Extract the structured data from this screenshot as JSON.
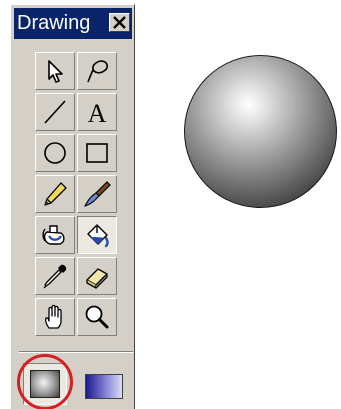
{
  "toolbox": {
    "title": "Drawing",
    "close_icon": "close-x-icon",
    "tools": [
      {
        "name": "arrow-tool",
        "icon": "arrow-icon",
        "pressed": false
      },
      {
        "name": "lasso-tool",
        "icon": "lasso-icon",
        "pressed": false
      },
      {
        "name": "line-tool",
        "icon": "line-icon",
        "pressed": false
      },
      {
        "name": "text-tool",
        "icon": "text-a-icon",
        "glyph": "A",
        "pressed": false
      },
      {
        "name": "oval-tool",
        "icon": "oval-icon",
        "pressed": false
      },
      {
        "name": "rectangle-tool",
        "icon": "rectangle-icon",
        "pressed": false
      },
      {
        "name": "pencil-tool",
        "icon": "pencil-icon",
        "pressed": false
      },
      {
        "name": "brush-tool",
        "icon": "brush-icon",
        "pressed": false
      },
      {
        "name": "ink-bottle-tool",
        "icon": "ink-bottle-icon",
        "pressed": false
      },
      {
        "name": "paint-bucket-tool",
        "icon": "paint-bucket-icon",
        "pressed": true
      },
      {
        "name": "eyedropper-tool",
        "icon": "eyedropper-icon",
        "pressed": false
      },
      {
        "name": "eraser-tool",
        "icon": "eraser-icon",
        "pressed": false
      },
      {
        "name": "hand-tool",
        "icon": "hand-icon",
        "pressed": false
      },
      {
        "name": "magnifier-tool",
        "icon": "magnifier-icon",
        "pressed": false
      }
    ],
    "fill_options": [
      {
        "name": "radial-gradient-fill",
        "selected": true,
        "highlighted": true
      },
      {
        "name": "linear-gradient-fill",
        "selected": false
      }
    ]
  },
  "colors": {
    "titlebar": "#0a246a",
    "panel": "#d4d0c8",
    "highlight_ring": "#d42020",
    "sphere_dark": "#161616",
    "sphere_light": "#ffffff"
  },
  "stage": {
    "shape": "radial-gradient-sphere"
  }
}
